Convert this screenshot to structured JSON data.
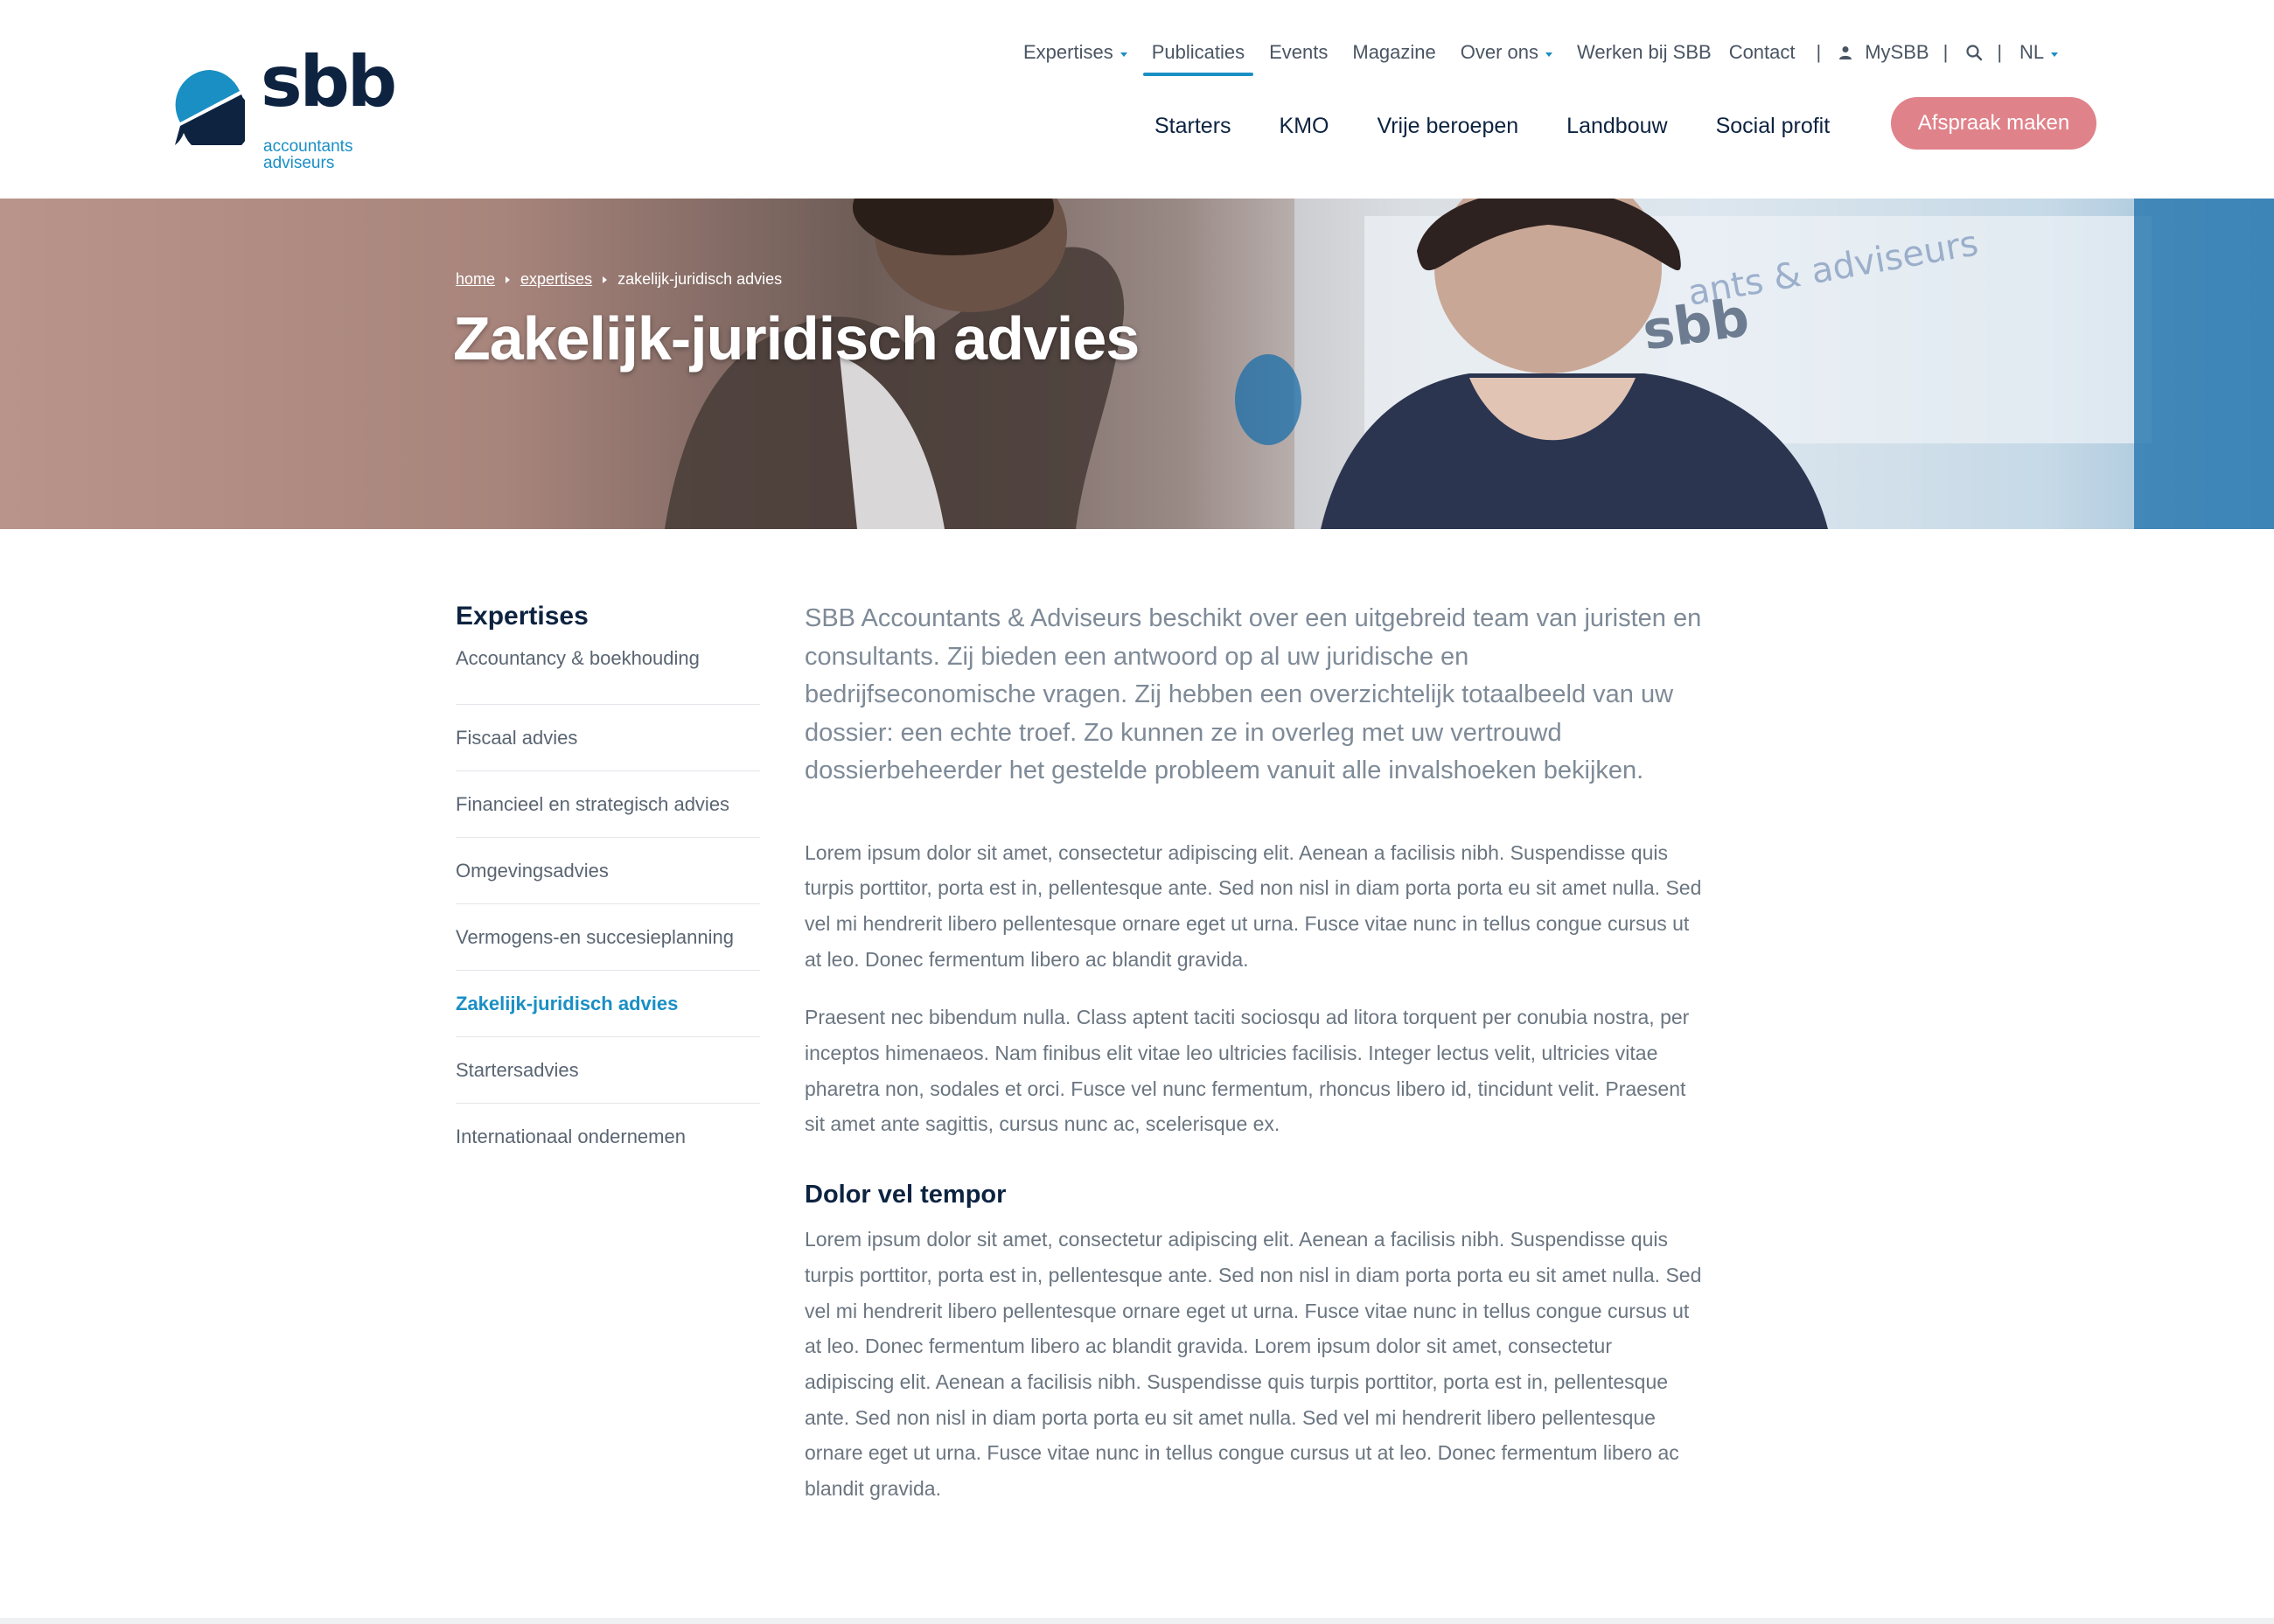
{
  "brand": {
    "name": "sbb",
    "subline_1": "accountants",
    "subline_2": "adviseurs",
    "colors": {
      "navy": "#0d2340",
      "blue": "#1a8fc4",
      "cta": "#e0828a"
    }
  },
  "topnav": {
    "items": [
      {
        "label": "Expertises",
        "dropdown": true
      },
      {
        "label": "Publicaties",
        "active": true
      },
      {
        "label": "Events"
      },
      {
        "label": "Magazine"
      },
      {
        "label": "Over ons",
        "dropdown": true
      },
      {
        "label": "Werken bij SBB"
      },
      {
        "label": "Contact"
      }
    ],
    "separator": "|",
    "account_label": "MySBB",
    "account_icon": "user-icon",
    "search_icon": "search-icon",
    "language": "NL"
  },
  "mainnav": {
    "items": [
      "Starters",
      "KMO",
      "Vrije beroepen",
      "Landbouw",
      "Social profit"
    ],
    "cta_label": "Afspraak maken"
  },
  "hero": {
    "breadcrumb": [
      "home",
      "expertises",
      "zakelijk-juridisch advies"
    ],
    "title": "Zakelijk-juridisch advies"
  },
  "sidebar": {
    "title": "Expertises",
    "items": [
      "Accountancy & boekhouding",
      "Fiscaal advies",
      "Financieel en strategisch advies",
      "Omgevingsadvies",
      "Vermogens-en succesieplanning",
      "Zakelijk-juridisch advies",
      "Startersadvies",
      "Internationaal ondernemen"
    ],
    "active_index": 5
  },
  "content": {
    "lead": "SBB Accountants & Adviseurs beschikt over een uitgebreid team van juristen en consultants. Zij bieden een antwoord op al uw juridische en bedrijfseconomische vragen. Zij hebben een overzichtelijk totaalbeeld van uw dossier: een echte troef. Zo kunnen ze in overleg met uw vertrouwd dossierbeheerder het gestelde probleem vanuit alle invalshoeken bekijken.",
    "para1": "Lorem ipsum dolor sit amet, consectetur adipiscing elit. Aenean a facilisis nibh. Suspendisse quis turpis porttitor, porta est in, pellentesque ante. Sed non nisl in diam porta porta eu sit amet nulla. Sed vel mi hendrerit libero pellentesque ornare eget ut urna. Fusce vitae nunc in tellus congue cursus ut at leo. Donec fermentum libero ac blandit gravida.",
    "para2": "Praesent nec bibendum nulla. Class aptent taciti sociosqu ad litora torquent per conubia nostra, per inceptos himenaeos. Nam finibus elit vitae leo ultricies facilisis. Integer lectus velit, ultricies vitae pharetra non, sodales et orci. Fusce vel nunc fermentum, rhoncus libero id, tincidunt velit. Praesent sit amet ante sagittis, cursus nunc ac, scelerisque ex.",
    "subhead": "Dolor vel tempor",
    "para3": "Lorem ipsum dolor sit amet, consectetur adipiscing elit. Aenean a facilisis nibh. Suspendisse quis turpis porttitor, porta est in, pellentesque ante. Sed non nisl in diam porta porta eu sit amet nulla. Sed vel mi hendrerit libero pellentesque ornare eget ut urna. Fusce vitae nunc in tellus congue cursus ut at leo. Donec fermentum libero ac blandit gravida. Lorem ipsum dolor sit amet, consectetur adipiscing elit. Aenean a facilisis nibh. Suspendisse quis turpis porttitor, porta est in, pellentesque ante. Sed non nisl in diam porta porta eu sit amet nulla. Sed vel mi hendrerit libero pellentesque ornare eget ut urna. Fusce vitae nunc in tellus congue cursus ut at leo. Donec fermentum libero ac blandit gravida."
  }
}
